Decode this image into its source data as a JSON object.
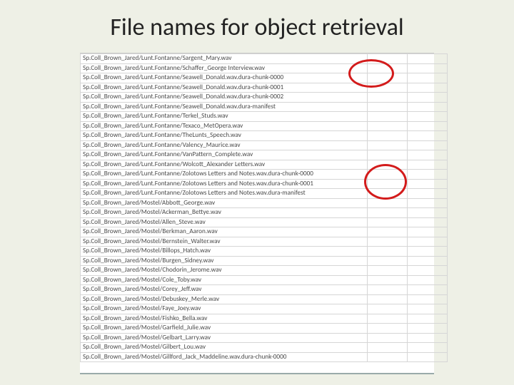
{
  "title": "File names for object retrieval",
  "rows": [
    "Sp.Coll_Brown_Jared/Lunt.Fontanne/Sargent_Mary.wav",
    "Sp.Coll_Brown_Jared/Lunt.Fontanne/Schaffer_George Interview.wav",
    "Sp.Coll_Brown_Jared/Lunt.Fontanne/Seawell_Donald.wav.dura-chunk-0000",
    "Sp.Coll_Brown_Jared/Lunt.Fontanne/Seawell_Donald.wav.dura-chunk-0001",
    "Sp.Coll_Brown_Jared/Lunt.Fontanne/Seawell_Donald.wav.dura-chunk-0002",
    "Sp.Coll_Brown_Jared/Lunt.Fontanne/Seawell_Donald.wav.dura-manifest",
    "Sp.Coll_Brown_Jared/Lunt.Fontanne/Terkel_Studs.wav",
    "Sp.Coll_Brown_Jared/Lunt.Fontanne/Texaco_MetOpera.wav",
    "Sp.Coll_Brown_Jared/Lunt.Fontanne/TheLunts_Speech.wav",
    "Sp.Coll_Brown_Jared/Lunt.Fontanne/Valency_Maurice.wav",
    "Sp.Coll_Brown_Jared/Lunt.Fontanne/VanPattern_Complete.wav",
    "Sp.Coll_Brown_Jared/Lunt.Fontanne/Wolcott_Alexander Letters.wav",
    "Sp.Coll_Brown_Jared/Lunt.Fontanne/Zolotows Letters and Notes.wav.dura-chunk-0000",
    "Sp.Coll_Brown_Jared/Lunt.Fontanne/Zolotows Letters and Notes.wav.dura-chunk-0001",
    "Sp.Coll_Brown_Jared/Lunt.Fontanne/Zolotows Letters and Notes.wav.dura-manifest",
    "Sp.Coll_Brown_Jared/Mostel/Abbott_George.wav",
    "Sp.Coll_Brown_Jared/Mostel/Ackerman_Bettye.wav",
    "Sp.Coll_Brown_Jared/Mostel/Allen_Steve.wav",
    "Sp.Coll_Brown_Jared/Mostel/Berkman_Aaron.wav",
    "Sp.Coll_Brown_Jared/Mostel/Bernstein_Walter.wav",
    "Sp.Coll_Brown_Jared/Mostel/Billops_Hatch.wav",
    "Sp.Coll_Brown_Jared/Mostel/Burgen_Sidney.wav",
    "Sp.Coll_Brown_Jared/Mostel/Chodorin_Jerome.wav",
    "Sp.Coll_Brown_Jared/Mostel/Cole_Toby.wav",
    "Sp.Coll_Brown_Jared/Mostel/Corey_Jeff.wav",
    "Sp.Coll_Brown_Jared/Mostel/Debuskey_Merle.wav",
    "Sp.Coll_Brown_Jared/Mostel/Faye_Joey.wav",
    "Sp.Coll_Brown_Jared/Mostel/Fishko_Bella.wav",
    "Sp.Coll_Brown_Jared/Mostel/Garfield_Julie.wav",
    "Sp.Coll_Brown_Jared/Mostel/Gelbart_Larry.wav",
    "Sp.Coll_Brown_Jared/Mostel/Gilbert_Lou.wav",
    "Sp.Coll_Brown_Jared/Mostel/Gillford_Jack_Maddeline.wav.dura-chunk-0000"
  ],
  "annotations": {
    "circle1": "red-circle-top",
    "circle2": "red-circle-bottom"
  }
}
